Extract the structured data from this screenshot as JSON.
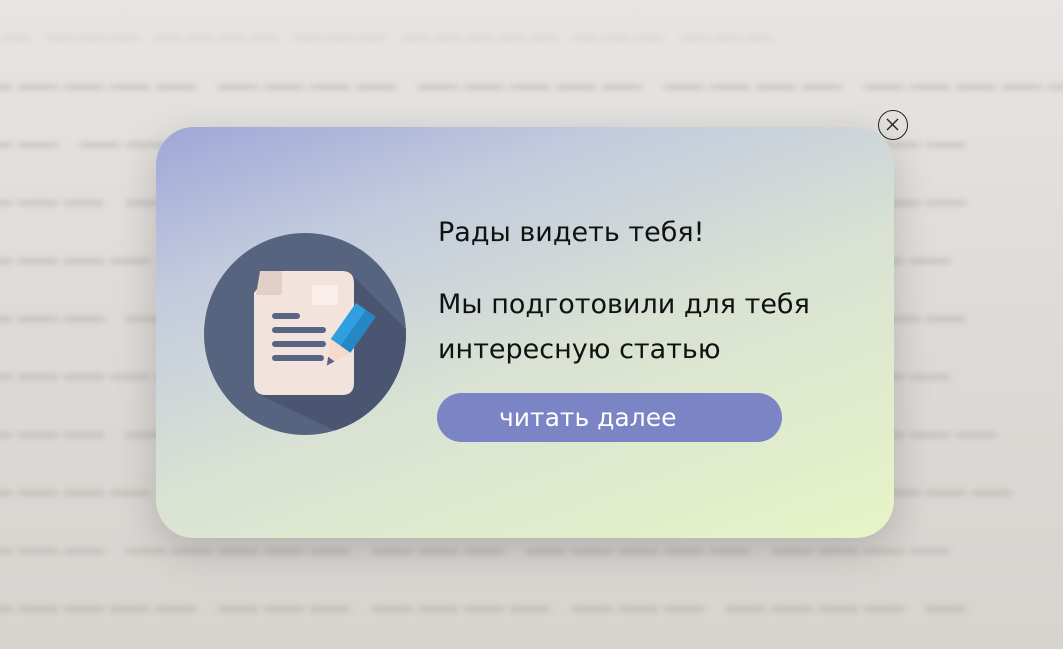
{
  "popup": {
    "greeting": "Рады видеть тебя!",
    "message": "Мы подготовили для тебя интересную статью",
    "cta_label": "читать далее",
    "close_icon": "close-x-icon",
    "illustration_icon": "document-pencil-icon"
  },
  "colors": {
    "cta_background": "#7b84c4",
    "cta_text": "#ffffff",
    "illustration_circle": "#576480",
    "pencil": "#2f9fe0"
  }
}
